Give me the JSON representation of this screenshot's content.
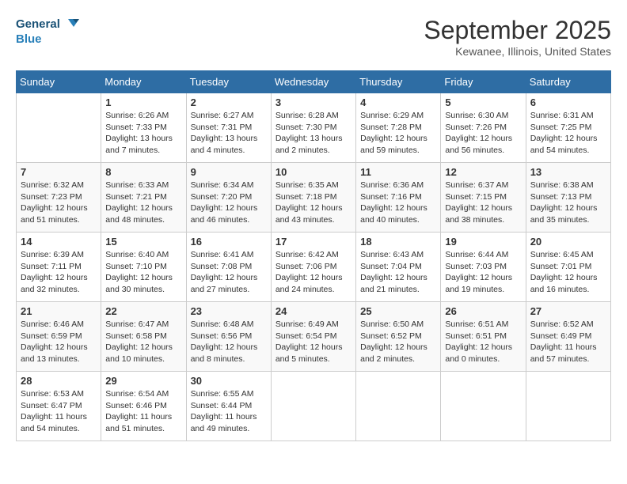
{
  "header": {
    "logo_line1": "General",
    "logo_line2": "Blue",
    "month": "September 2025",
    "location": "Kewanee, Illinois, United States"
  },
  "days_of_week": [
    "Sunday",
    "Monday",
    "Tuesday",
    "Wednesday",
    "Thursday",
    "Friday",
    "Saturday"
  ],
  "weeks": [
    [
      {
        "day": "",
        "info": ""
      },
      {
        "day": "1",
        "info": "Sunrise: 6:26 AM\nSunset: 7:33 PM\nDaylight: 13 hours\nand 7 minutes."
      },
      {
        "day": "2",
        "info": "Sunrise: 6:27 AM\nSunset: 7:31 PM\nDaylight: 13 hours\nand 4 minutes."
      },
      {
        "day": "3",
        "info": "Sunrise: 6:28 AM\nSunset: 7:30 PM\nDaylight: 13 hours\nand 2 minutes."
      },
      {
        "day": "4",
        "info": "Sunrise: 6:29 AM\nSunset: 7:28 PM\nDaylight: 12 hours\nand 59 minutes."
      },
      {
        "day": "5",
        "info": "Sunrise: 6:30 AM\nSunset: 7:26 PM\nDaylight: 12 hours\nand 56 minutes."
      },
      {
        "day": "6",
        "info": "Sunrise: 6:31 AM\nSunset: 7:25 PM\nDaylight: 12 hours\nand 54 minutes."
      }
    ],
    [
      {
        "day": "7",
        "info": "Sunrise: 6:32 AM\nSunset: 7:23 PM\nDaylight: 12 hours\nand 51 minutes."
      },
      {
        "day": "8",
        "info": "Sunrise: 6:33 AM\nSunset: 7:21 PM\nDaylight: 12 hours\nand 48 minutes."
      },
      {
        "day": "9",
        "info": "Sunrise: 6:34 AM\nSunset: 7:20 PM\nDaylight: 12 hours\nand 46 minutes."
      },
      {
        "day": "10",
        "info": "Sunrise: 6:35 AM\nSunset: 7:18 PM\nDaylight: 12 hours\nand 43 minutes."
      },
      {
        "day": "11",
        "info": "Sunrise: 6:36 AM\nSunset: 7:16 PM\nDaylight: 12 hours\nand 40 minutes."
      },
      {
        "day": "12",
        "info": "Sunrise: 6:37 AM\nSunset: 7:15 PM\nDaylight: 12 hours\nand 38 minutes."
      },
      {
        "day": "13",
        "info": "Sunrise: 6:38 AM\nSunset: 7:13 PM\nDaylight: 12 hours\nand 35 minutes."
      }
    ],
    [
      {
        "day": "14",
        "info": "Sunrise: 6:39 AM\nSunset: 7:11 PM\nDaylight: 12 hours\nand 32 minutes."
      },
      {
        "day": "15",
        "info": "Sunrise: 6:40 AM\nSunset: 7:10 PM\nDaylight: 12 hours\nand 30 minutes."
      },
      {
        "day": "16",
        "info": "Sunrise: 6:41 AM\nSunset: 7:08 PM\nDaylight: 12 hours\nand 27 minutes."
      },
      {
        "day": "17",
        "info": "Sunrise: 6:42 AM\nSunset: 7:06 PM\nDaylight: 12 hours\nand 24 minutes."
      },
      {
        "day": "18",
        "info": "Sunrise: 6:43 AM\nSunset: 7:04 PM\nDaylight: 12 hours\nand 21 minutes."
      },
      {
        "day": "19",
        "info": "Sunrise: 6:44 AM\nSunset: 7:03 PM\nDaylight: 12 hours\nand 19 minutes."
      },
      {
        "day": "20",
        "info": "Sunrise: 6:45 AM\nSunset: 7:01 PM\nDaylight: 12 hours\nand 16 minutes."
      }
    ],
    [
      {
        "day": "21",
        "info": "Sunrise: 6:46 AM\nSunset: 6:59 PM\nDaylight: 12 hours\nand 13 minutes."
      },
      {
        "day": "22",
        "info": "Sunrise: 6:47 AM\nSunset: 6:58 PM\nDaylight: 12 hours\nand 10 minutes."
      },
      {
        "day": "23",
        "info": "Sunrise: 6:48 AM\nSunset: 6:56 PM\nDaylight: 12 hours\nand 8 minutes."
      },
      {
        "day": "24",
        "info": "Sunrise: 6:49 AM\nSunset: 6:54 PM\nDaylight: 12 hours\nand 5 minutes."
      },
      {
        "day": "25",
        "info": "Sunrise: 6:50 AM\nSunset: 6:52 PM\nDaylight: 12 hours\nand 2 minutes."
      },
      {
        "day": "26",
        "info": "Sunrise: 6:51 AM\nSunset: 6:51 PM\nDaylight: 12 hours\nand 0 minutes."
      },
      {
        "day": "27",
        "info": "Sunrise: 6:52 AM\nSunset: 6:49 PM\nDaylight: 11 hours\nand 57 minutes."
      }
    ],
    [
      {
        "day": "28",
        "info": "Sunrise: 6:53 AM\nSunset: 6:47 PM\nDaylight: 11 hours\nand 54 minutes."
      },
      {
        "day": "29",
        "info": "Sunrise: 6:54 AM\nSunset: 6:46 PM\nDaylight: 11 hours\nand 51 minutes."
      },
      {
        "day": "30",
        "info": "Sunrise: 6:55 AM\nSunset: 6:44 PM\nDaylight: 11 hours\nand 49 minutes."
      },
      {
        "day": "",
        "info": ""
      },
      {
        "day": "",
        "info": ""
      },
      {
        "day": "",
        "info": ""
      },
      {
        "day": "",
        "info": ""
      }
    ]
  ]
}
